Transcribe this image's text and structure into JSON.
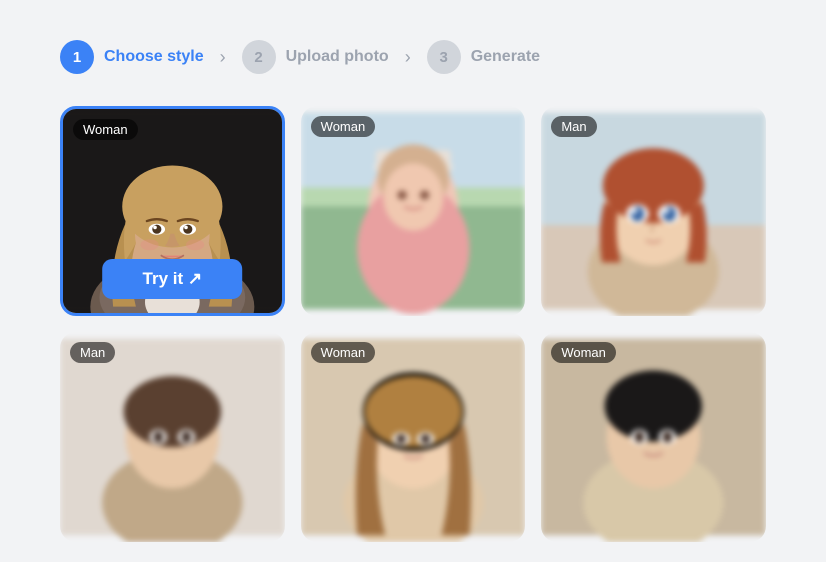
{
  "stepper": {
    "steps": [
      {
        "number": "1",
        "label": "Choose style",
        "state": "active"
      },
      {
        "number": "2",
        "label": "Upload photo",
        "state": "inactive"
      },
      {
        "number": "3",
        "label": "Generate",
        "state": "inactive"
      }
    ]
  },
  "grid": {
    "cards": [
      {
        "id": "card-1",
        "badge": "Woman",
        "selected": true,
        "blurred": false,
        "try_label": "Try it ↗",
        "row": 0
      },
      {
        "id": "card-2",
        "badge": "Woman",
        "selected": false,
        "blurred": true,
        "row": 0
      },
      {
        "id": "card-3",
        "badge": "Man",
        "selected": false,
        "blurred": true,
        "row": 0
      },
      {
        "id": "card-4",
        "badge": "Man",
        "selected": false,
        "blurred": true,
        "row": 1
      },
      {
        "id": "card-5",
        "badge": "Woman",
        "selected": false,
        "blurred": true,
        "row": 1
      },
      {
        "id": "card-6",
        "badge": "Woman",
        "selected": false,
        "blurred": true,
        "row": 1
      }
    ],
    "try_button_label": "Try it ↗"
  }
}
